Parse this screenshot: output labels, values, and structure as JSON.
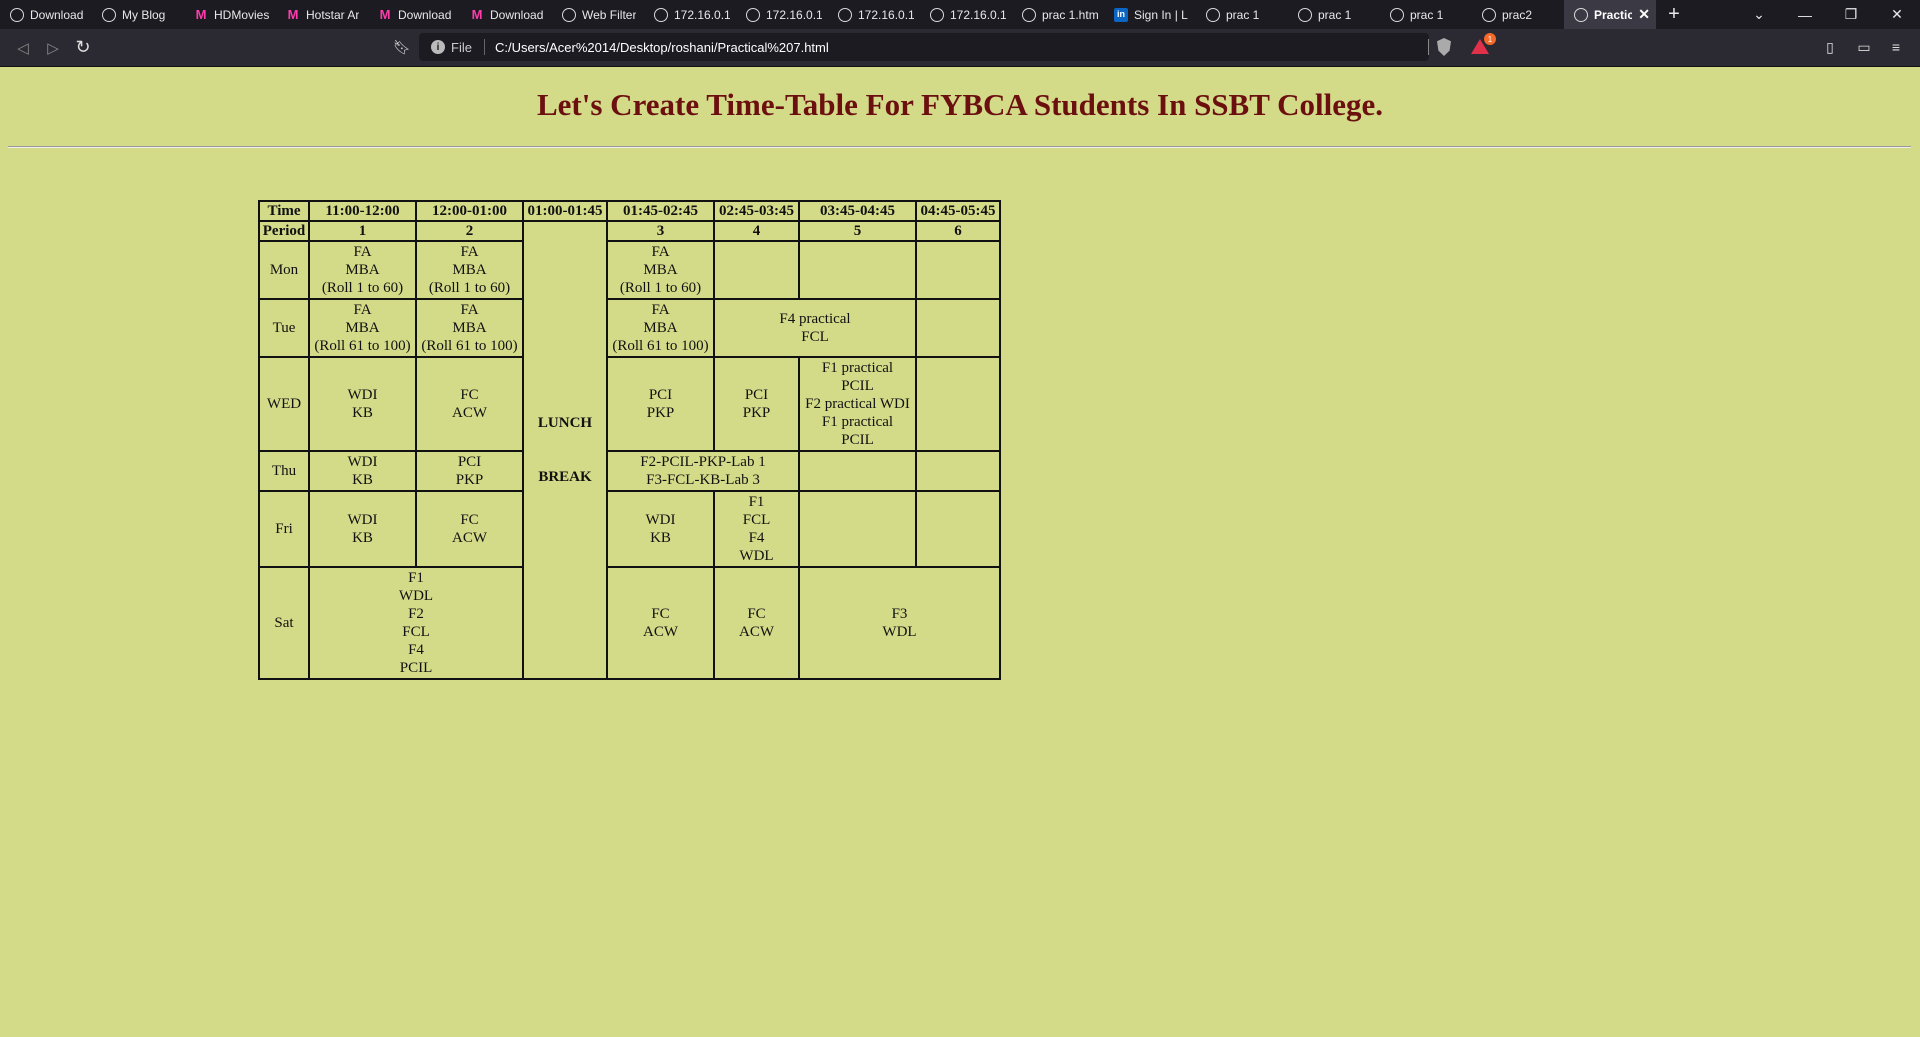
{
  "browser": {
    "tabs": [
      {
        "label": "Download",
        "icon": "globe-icon"
      },
      {
        "label": "My Blog",
        "icon": "globe-icon"
      },
      {
        "label": "HDMovies",
        "icon": "m-logo-icon"
      },
      {
        "label": "Hotstar Ar",
        "icon": "m-logo-icon"
      },
      {
        "label": "Download",
        "icon": "m-logo-icon"
      },
      {
        "label": "Download",
        "icon": "m-logo-icon"
      },
      {
        "label": "Web Filter",
        "icon": "globe-icon"
      },
      {
        "label": "172.16.0.1",
        "icon": "globe-icon"
      },
      {
        "label": "172.16.0.1",
        "icon": "globe-icon"
      },
      {
        "label": "172.16.0.1",
        "icon": "globe-icon"
      },
      {
        "label": "172.16.0.1",
        "icon": "globe-icon"
      },
      {
        "label": "prac 1.htm",
        "icon": "globe-icon"
      },
      {
        "label": "Sign In | L",
        "icon": "linkedin-icon"
      },
      {
        "label": "prac 1",
        "icon": "globe-icon"
      },
      {
        "label": "prac 1",
        "icon": "globe-icon"
      },
      {
        "label": "prac 1",
        "icon": "globe-icon"
      },
      {
        "label": "prac2",
        "icon": "globe-icon"
      },
      {
        "label": "Practic",
        "icon": "globe-icon",
        "active": true
      }
    ],
    "url_scheme_label": "File",
    "url": "C:/Users/Acer%2014/Desktop/roshani/Practical%207.html",
    "rewards_badge_count": "1"
  },
  "page": {
    "title": "Let's Create Time-Table For FYBCA Students In SSBT College."
  },
  "timetable": {
    "header_time": [
      "Time",
      "11:00-12:00",
      "12:00-01:00",
      "01:00-01:45",
      "01:45-02:45",
      "02:45-03:45",
      "03:45-04:45",
      "04:45-05:45"
    ],
    "header_period": [
      "Period",
      "1",
      "2",
      "3",
      "4",
      "5",
      "6"
    ],
    "lunch": [
      "LUNCH",
      "BREAK"
    ],
    "days": [
      "Mon",
      "Tue",
      "WED",
      "Thu",
      "Fri",
      "Sat"
    ],
    "mon": {
      "p1": [
        "FA",
        "MBA",
        "(Roll 1 to 60)"
      ],
      "p2": [
        "FA",
        "MBA",
        "(Roll 1 to 60)"
      ],
      "p3": [
        "FA",
        "MBA",
        "(Roll 1 to 60)"
      ]
    },
    "tue": {
      "p1": [
        "FA",
        "MBA",
        "(Roll 61 to 100)"
      ],
      "p2": [
        "FA",
        "MBA",
        "(Roll 61 to 100)"
      ],
      "p3": [
        "FA",
        "MBA",
        "(Roll 61 to 100)"
      ],
      "p4_5": [
        "F4 practical",
        "FCL"
      ]
    },
    "wed": {
      "p1": [
        "WDI",
        "KB"
      ],
      "p2": [
        "FC",
        "ACW"
      ],
      "p3": [
        "PCI",
        "PKP"
      ],
      "p4": [
        "PCI",
        "PKP"
      ],
      "p5": [
        "F1 practical",
        "PCIL",
        "F2 practical WDI",
        "F1 practical",
        "PCIL"
      ]
    },
    "thu": {
      "p1": [
        "WDI",
        "KB"
      ],
      "p2": [
        "PCI",
        "PKP"
      ],
      "p3_4": [
        "F2-PCIL-PKP-Lab 1",
        "F3-FCL-KB-Lab 3"
      ]
    },
    "fri": {
      "p1": [
        "WDI",
        "KB"
      ],
      "p2": [
        "FC",
        "ACW"
      ],
      "p3": [
        "WDI",
        "KB"
      ],
      "p4": [
        "F1",
        "FCL",
        "F4",
        "WDL"
      ]
    },
    "sat": {
      "p1_2": [
        "F1",
        "WDL",
        "F2",
        "FCL",
        "F4",
        "PCIL"
      ],
      "p3": [
        "FC",
        "ACW"
      ],
      "p4": [
        "FC",
        "ACW"
      ],
      "p5_6": [
        "F3",
        "WDL"
      ]
    }
  }
}
